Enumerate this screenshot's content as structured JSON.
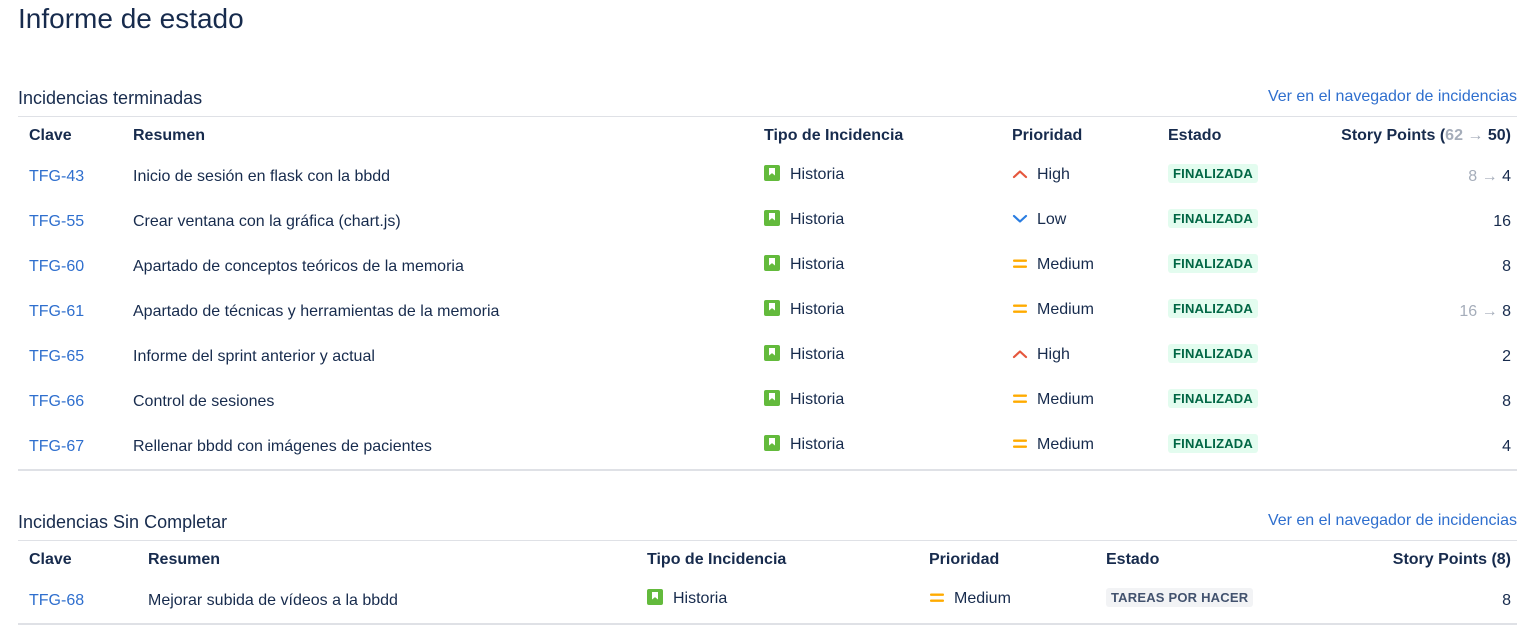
{
  "page": {
    "title": "Informe de estado"
  },
  "sections": {
    "completed": {
      "title": "Incidencias terminadas",
      "link": "Ver en el navegador de incidencias",
      "headers": {
        "key": "Clave",
        "summary": "Resumen",
        "type": "Tipo de Incidencia",
        "priority": "Prioridad",
        "status": "Estado",
        "sp_label": "Story Points (",
        "sp_old": "62",
        "sp_arrow": "→",
        "sp_new": "50)"
      },
      "rows": [
        {
          "key": "TFG-43",
          "summary": "Inicio de sesión en flask con la bbdd",
          "type": "Historia",
          "priority": "High",
          "priority_icon": "priority-high-icon",
          "status": "FINALIZADA",
          "sp_old": "8",
          "sp_arrow": "→",
          "sp_new": "4"
        },
        {
          "key": "TFG-55",
          "summary": "Crear ventana con la gráfica (chart.js)",
          "type": "Historia",
          "priority": "Low",
          "priority_icon": "priority-low-icon",
          "status": "FINALIZADA",
          "sp": "16"
        },
        {
          "key": "TFG-60",
          "summary": "Apartado de conceptos teóricos de la memoria",
          "type": "Historia",
          "priority": "Medium",
          "priority_icon": "priority-medium-icon",
          "status": "FINALIZADA",
          "sp": "8"
        },
        {
          "key": "TFG-61",
          "summary": "Apartado de técnicas y herramientas de la memoria",
          "type": "Historia",
          "priority": "Medium",
          "priority_icon": "priority-medium-icon",
          "status": "FINALIZADA",
          "sp_old": "16",
          "sp_arrow": "→",
          "sp_new": "8"
        },
        {
          "key": "TFG-65",
          "summary": "Informe del sprint anterior y actual",
          "type": "Historia",
          "priority": "High",
          "priority_icon": "priority-high-icon",
          "status": "FINALIZADA",
          "sp": "2"
        },
        {
          "key": "TFG-66",
          "summary": "Control de sesiones",
          "type": "Historia",
          "priority": "Medium",
          "priority_icon": "priority-medium-icon",
          "status": "FINALIZADA",
          "sp": "8"
        },
        {
          "key": "TFG-67",
          "summary": "Rellenar bbdd con imágenes de pacientes",
          "type": "Historia",
          "priority": "Medium",
          "priority_icon": "priority-medium-icon",
          "status": "FINALIZADA",
          "sp": "4"
        }
      ]
    },
    "incomplete": {
      "title": "Incidencias Sin Completar",
      "link": "Ver en el navegador de incidencias",
      "headers": {
        "key": "Clave",
        "summary": "Resumen",
        "type": "Tipo de Incidencia",
        "priority": "Prioridad",
        "status": "Estado",
        "sp": "Story Points (8)"
      },
      "rows": [
        {
          "key": "TFG-68",
          "summary": "Mejorar subida de vídeos a la bbdd",
          "type": "Historia",
          "priority": "Medium",
          "priority_icon": "priority-medium-icon",
          "status": "TAREAS POR HACER",
          "sp": "8"
        }
      ]
    }
  },
  "colors": {
    "link": "#2f6fce",
    "story": "#63ba3c",
    "high": "#e5573d",
    "low": "#2a7de1",
    "medium": "#ffab00",
    "done_bg": "#e3fcef",
    "done_fg": "#006644",
    "todo_bg": "#f2f3f5",
    "todo_fg": "#42526e"
  }
}
